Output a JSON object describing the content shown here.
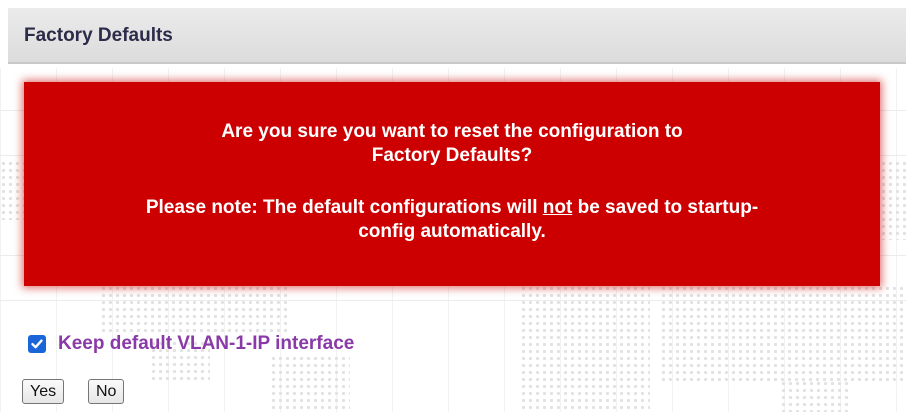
{
  "header": {
    "title": "Factory Defaults"
  },
  "alert": {
    "line1": "Are you sure you want to reset the configuration to",
    "line2": "Factory Defaults?",
    "note_prefix": "Please note: The default configurations will ",
    "note_emphasis": "not",
    "note_suffix": " be saved to startup-",
    "note_line2": "config automatically.",
    "background_color": "#cc0000"
  },
  "options": {
    "keep_vlan_label": "Keep default VLAN-1-IP interface",
    "keep_vlan_checked": true
  },
  "buttons": {
    "yes_label": "Yes",
    "no_label": "No"
  }
}
